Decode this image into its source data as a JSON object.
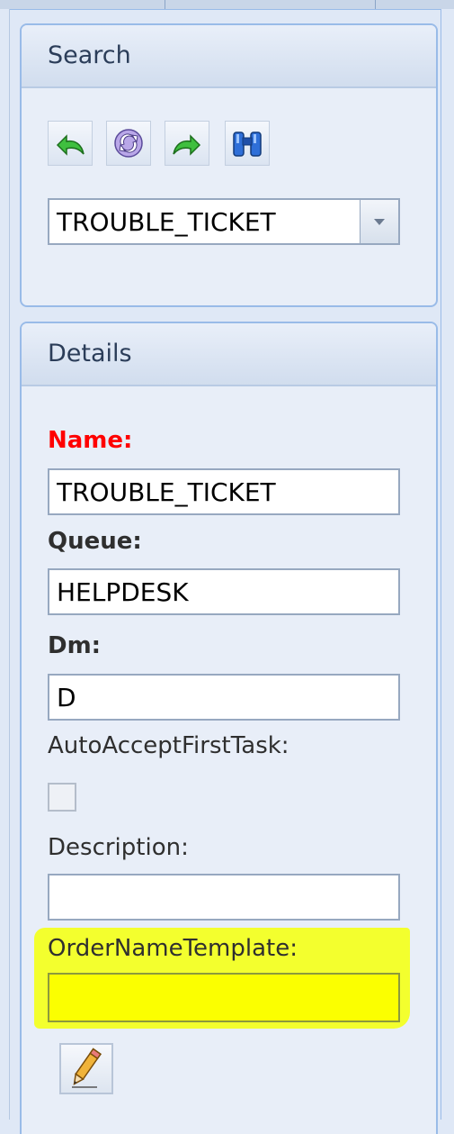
{
  "search_panel": {
    "title": "Search",
    "toolbar": [
      {
        "name": "back-arrow-icon"
      },
      {
        "name": "refresh-icon"
      },
      {
        "name": "forward-arrow-icon"
      },
      {
        "name": "binoculars-icon"
      }
    ],
    "combo_value": "TROUBLE_TICKET"
  },
  "details_panel": {
    "title": "Details",
    "name_label": "Name:",
    "name_value": "TROUBLE_TICKET",
    "queue_label": "Queue:",
    "queue_value": "HELPDESK",
    "dm_label": "Dm:",
    "dm_value": "D",
    "auto_accept_label": "AutoAcceptFirstTask:",
    "auto_accept_checked": false,
    "description_label": "Description:",
    "description_value": "",
    "order_name_label": "OrderNameTemplate:",
    "order_name_value": ""
  },
  "colors": {
    "required_label": "#ff0000",
    "highlight": "#f3ff2e"
  },
  "icons": {
    "edit": "pencil-icon"
  }
}
